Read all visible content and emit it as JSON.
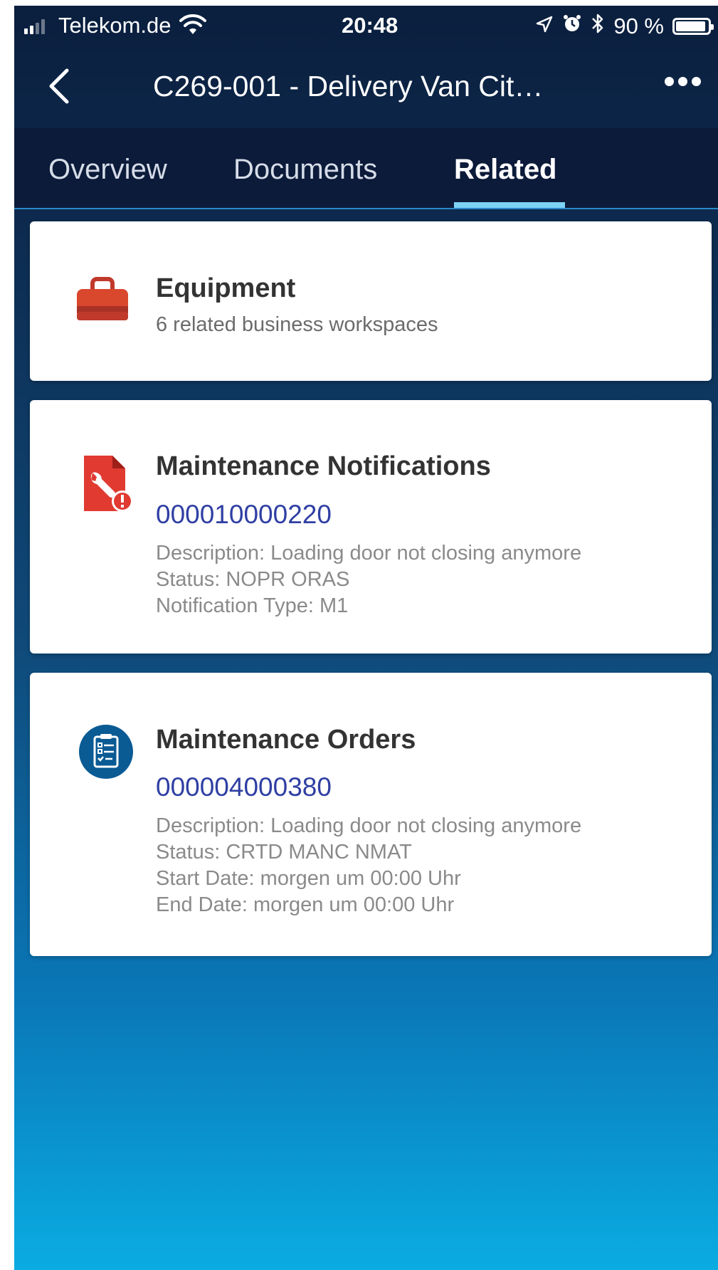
{
  "status_bar": {
    "carrier": "Telekom.de",
    "time": "20:48",
    "battery": "90 %",
    "battery_level": 0.9,
    "icons": [
      "signal-icon",
      "wifi-icon",
      "location-arrow-icon",
      "alarm-icon",
      "bluetooth-icon",
      "battery-icon"
    ]
  },
  "nav": {
    "title": "C269-001 - Delivery Van Cit…",
    "back_icon": "chevron-left-icon",
    "more_icon": "more-icon"
  },
  "tabs": [
    {
      "label": "Overview",
      "active": false
    },
    {
      "label": "Documents",
      "active": false
    },
    {
      "label": "Related",
      "active": true
    }
  ],
  "cards": {
    "equipment": {
      "icon": "toolbox-icon",
      "title": "Equipment",
      "subtitle": "6 related business workspaces",
      "color": "#c0392b"
    },
    "notifications": {
      "icon": "wrench-alert-icon",
      "title": "Maintenance Notifications",
      "number": "000010000220",
      "details": [
        "Description: Loading door not closing anymore",
        "Status: NOPR ORAS",
        "Notification Type: M1"
      ],
      "color": "#e03a31"
    },
    "orders": {
      "icon": "clipboard-checklist-icon",
      "title": "Maintenance Orders",
      "number": "000004000380",
      "details": [
        "Description: Loading door not closing anymore",
        "Status: CRTD MANC NMAT",
        "Start Date: morgen um 00:00 Uhr",
        "End Date: morgen um 00:00 Uhr"
      ],
      "color": "#0a5a94"
    }
  },
  "colors": {
    "link": "#2f3fa3",
    "tab_indicator": "#7dd3f5",
    "header_bg": "#0c1b3a"
  }
}
